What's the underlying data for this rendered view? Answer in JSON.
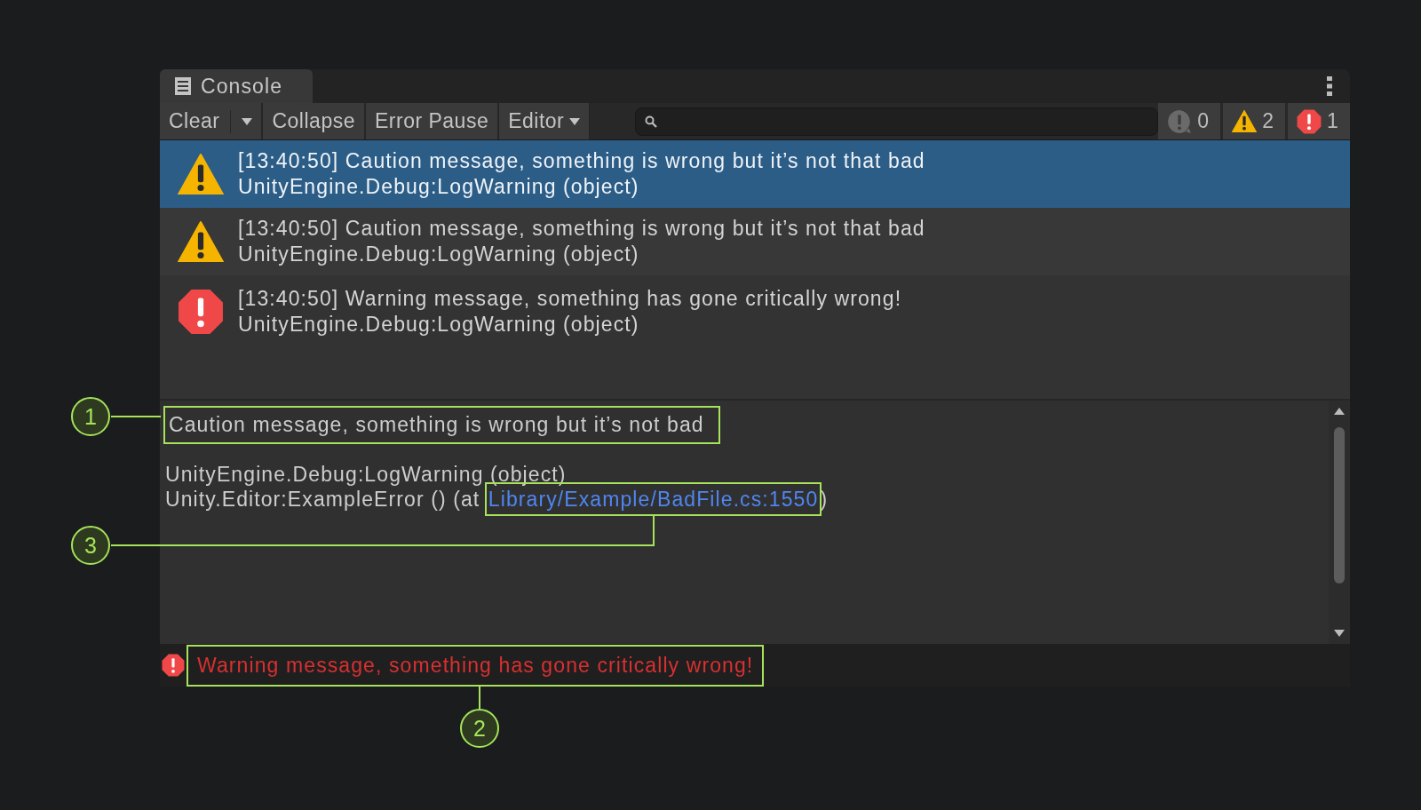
{
  "window": {
    "tab": "Console"
  },
  "toolbar": {
    "buttons": [
      {
        "label": "Clear",
        "kind": "split"
      },
      {
        "label": "Collapse",
        "kind": "plain"
      },
      {
        "label": "Error Pause",
        "kind": "plain"
      },
      {
        "label": "Editor",
        "kind": "dropdown"
      }
    ],
    "counters": [
      {
        "kind": "info",
        "count": "0"
      },
      {
        "kind": "warning",
        "count": "2"
      },
      {
        "kind": "error",
        "count": "1"
      }
    ]
  },
  "log": [
    {
      "kind": "warning",
      "selected": true,
      "message": "[13:40:50] Caution message, something is wrong but it’s not that bad",
      "source": "UnityEngine.Debug:LogWarning (object)"
    },
    {
      "kind": "warning",
      "selected": false,
      "message": "[13:40:50] Caution message, something is wrong but it’s not that bad",
      "source": "UnityEngine.Debug:LogWarning (object)"
    },
    {
      "kind": "error",
      "selected": false,
      "message": "[13:40:50] Warning message, something has gone critically wrong!",
      "source": "UnityEngine.Debug:LogWarning (object)"
    }
  ],
  "detail": {
    "message": "Caution message, something is wrong but it’s not bad",
    "highlighted": true,
    "stack": [
      {
        "text": "UnityEngine.Debug:LogWarning (object)"
      },
      {
        "text": "Unity.Editor:ExampleError () (at ",
        "link": "Library/Example/BadFile.cs:1550",
        "after": ")",
        "highlighted": true
      }
    ]
  },
  "status_bar": {
    "kind": "error",
    "message": "Warning message, something has gone critically wrong!",
    "highlighted": true
  },
  "annotations": [
    {
      "number": "1"
    },
    {
      "number": "3"
    },
    {
      "number": "2"
    }
  ]
}
